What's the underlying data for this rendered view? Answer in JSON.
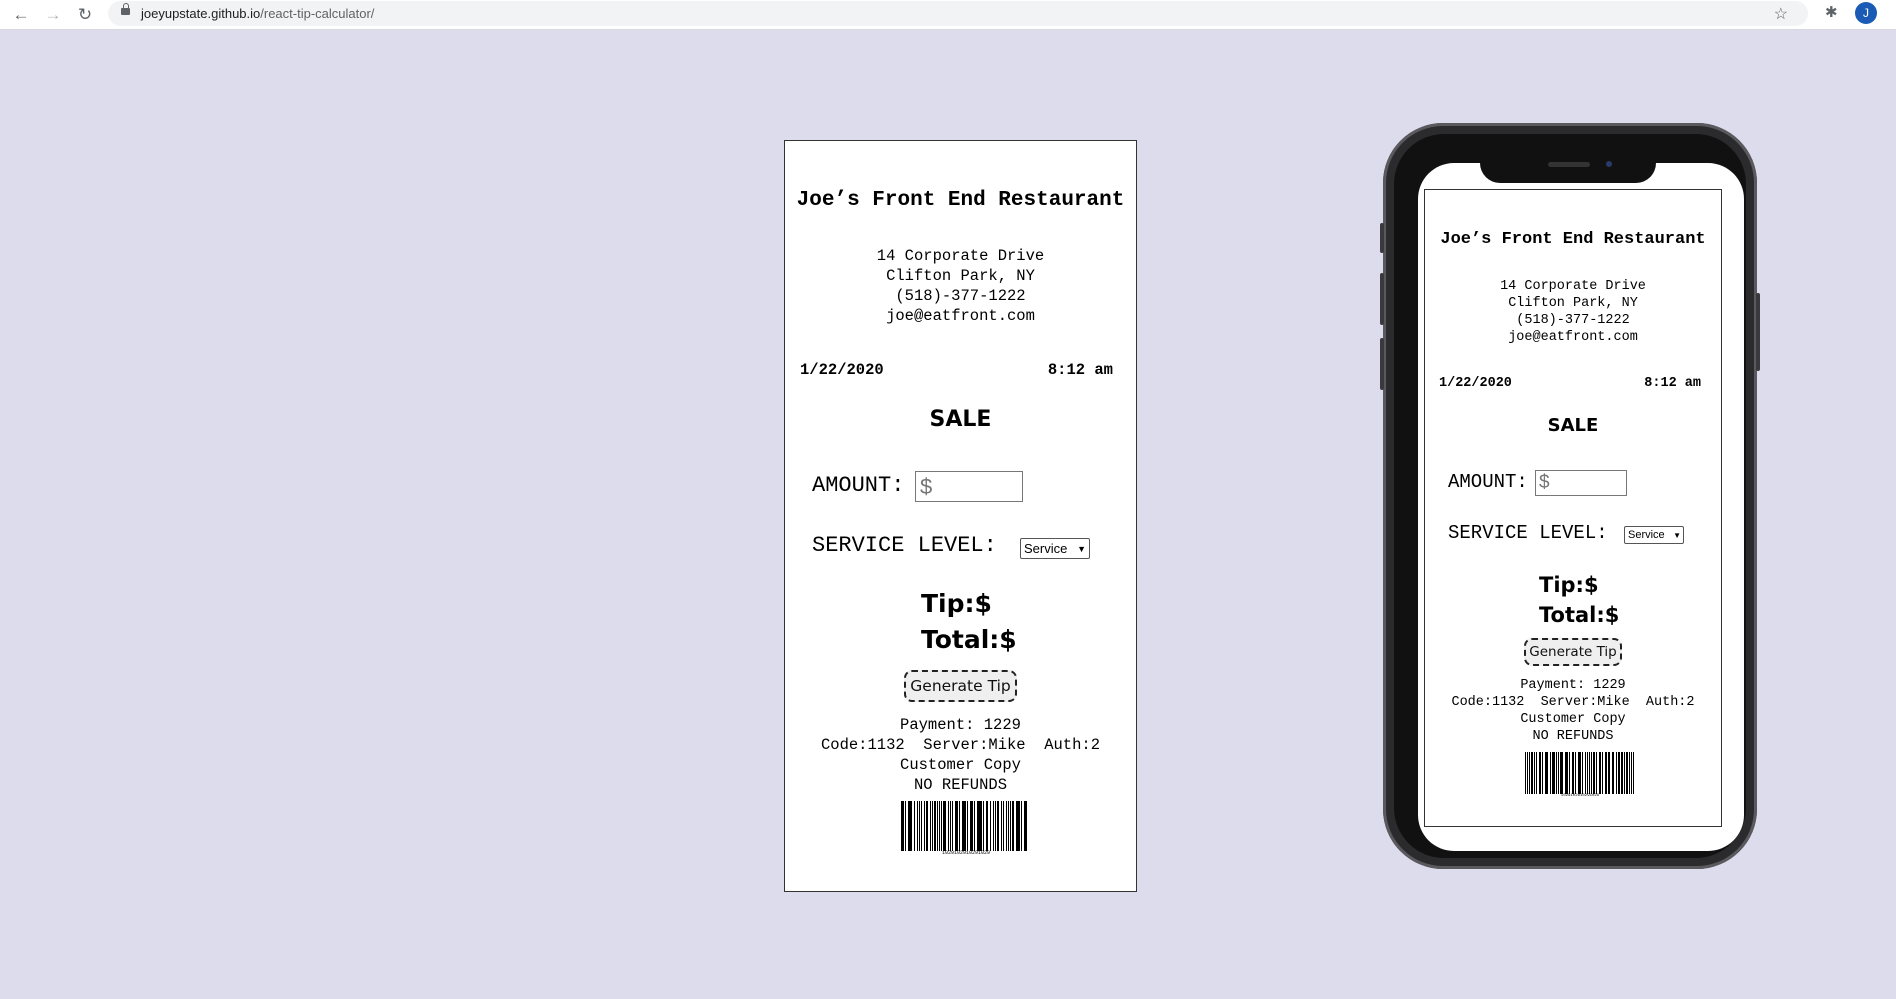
{
  "browser": {
    "back_icon": "←",
    "forward_icon": "→",
    "reload_icon": "↻",
    "url_host": "joeyupstate.github.io",
    "url_path": "/react-tip-calculator/",
    "star_icon": "☆",
    "extensions_icon": "✱",
    "avatar_letter": "J"
  },
  "receipt": {
    "restaurant_name": "Joe’s Front End Restaurant",
    "address_line1": "14 Corporate Drive",
    "address_line2": "Clifton Park, NY",
    "phone": "(518)-377-1222",
    "email": "joe@eatfront.com",
    "date": "1/22/2020",
    "time": "8:12 am",
    "sale_label": "SALE",
    "amount_label": "AMOUNT:",
    "amount_placeholder": "$",
    "service_label": "SERVICE LEVEL:",
    "service_selected": "Service",
    "tip_label": "Tip:$",
    "total_label": "Total:$",
    "generate_button": "Generate Tip",
    "payment_line": "Payment: 1229",
    "code_line": "Code:1132  Server:Mike  Auth:2",
    "copy_line": "Customer Copy",
    "refund_line": "NO REFUNDS",
    "barcode_number": "1029102910291029"
  },
  "colors": {
    "background": "#dddced",
    "receipt_bg": "#ffffff",
    "phone_frame": "#2b2b2e"
  }
}
